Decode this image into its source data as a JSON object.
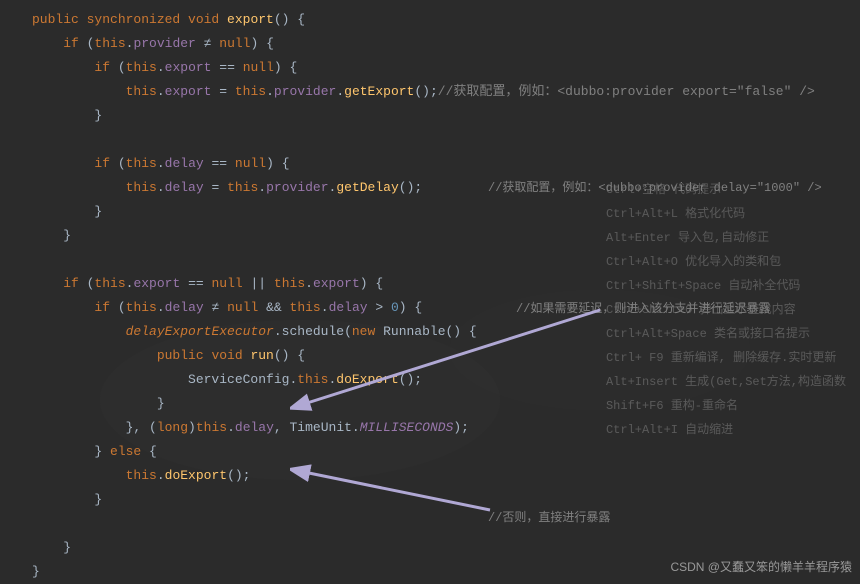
{
  "code": {
    "l1a": "public",
    "l1b": " synchronized ",
    "l1c": "void ",
    "l1d": "export",
    "l1e": "() {",
    "l2a": "    if ",
    "l2b": "(",
    "l2c": "this",
    "l2d": ".",
    "l2e": "provider",
    "l2f": " ≠ ",
    "l2g": "null",
    "l2h": ") {",
    "l3a": "        if ",
    "l3b": "(",
    "l3c": "this",
    "l3d": ".",
    "l3e": "export",
    "l3f": " == ",
    "l3g": "null",
    "l3h": ") {",
    "l4a": "            ",
    "l4b": "this",
    "l4c": ".",
    "l4d": "export",
    "l4e": " = ",
    "l4f": "this",
    "l4g": ".",
    "l4h": "provider",
    "l4i": ".",
    "l4j": "getExport",
    "l4k": "();",
    "l5": "        }",
    "l6": "",
    "l7a": "        if ",
    "l7b": "(",
    "l7c": "this",
    "l7d": ".",
    "l7e": "delay",
    "l7f": " == ",
    "l7g": "null",
    "l7h": ") {",
    "l8a": "            ",
    "l8b": "this",
    "l8c": ".",
    "l8d": "delay",
    "l8e": " = ",
    "l8f": "this",
    "l8g": ".",
    "l8h": "provider",
    "l8i": ".",
    "l8j": "getDelay",
    "l8k": "();",
    "l9": "        }",
    "l10": "    }",
    "l11": "",
    "l12a": "    if ",
    "l12b": "(",
    "l12c": "this",
    "l12d": ".",
    "l12e": "export",
    "l12f": " == ",
    "l12g": "null",
    "l12h": " || ",
    "l12i": "this",
    "l12j": ".",
    "l12k": "export",
    "l12l": ") {",
    "l13a": "        if ",
    "l13b": "(",
    "l13c": "this",
    "l13d": ".",
    "l13e": "delay",
    "l13f": " ≠ ",
    "l13g": "null",
    "l13h": " && ",
    "l13i": "this",
    "l13j": ".",
    "l13k": "delay",
    "l13l": " > ",
    "l13m": "0",
    "l13n": ") {",
    "l14a": "            ",
    "l14b": "delayExportExecutor",
    "l14c": ".schedule(",
    "l14d": "new ",
    "l14e": "Runnable() {",
    "l15a": "                ",
    "l15b": "public ",
    "l15c": "void ",
    "l15d": "run",
    "l15e": "() {",
    "l16a": "                    ServiceConfig.",
    "l16b": "this",
    "l16c": ".",
    "l16d": "doExport",
    "l16e": "();",
    "l17": "                }",
    "l18a": "            }, (",
    "l18b": "long",
    "l18c": ")",
    "l18d": "this",
    "l18e": ".",
    "l18f": "delay",
    "l18g": ", TimeUnit.",
    "l18h": "MILLISECONDS",
    "l18i": ");",
    "l19a": "        } ",
    "l19b": "else ",
    "l19c": "{",
    "l20a": "            ",
    "l20b": "this",
    "l20c": ".",
    "l20d": "doExport",
    "l20e": "();",
    "l21": "        }",
    "l22": "",
    "l23": "    }",
    "l24": "}"
  },
  "comments": {
    "c1": "//获取配置，例如：<dubbo:provider export=\"false\" />",
    "c2": "//获取配置，例如：<dubbo:provider delay=\"1000\" />",
    "c3": "//如果需要延迟，则进入该分支并进行延迟暴露",
    "c4": "//否则，直接进行暴露"
  },
  "hints": [
    "Ctrl+空格  代码提示",
    "Ctrl+Alt+L  格式化代码",
    "Alt+Enter 导入包,自动修正",
    "Ctrl+Alt+O 优化导入的类和包",
    "Ctrl+Shift+Space 自动补全代码",
    "Ctrl+Shift+O  弹出显示查找内容",
    "Ctrl+Alt+Space  类名或接口名提示",
    "Ctrl+ F9 重新编译, 删除缓存.实时更新",
    "Alt+Insert  生成(Get,Set方法,构造函数",
    "",
    "Shift+F6  重构-重命名",
    "Ctrl+Alt+I  自动缩进",
    ""
  ],
  "watermark": "CSDN @又蠢又笨的懒羊羊程序猿"
}
